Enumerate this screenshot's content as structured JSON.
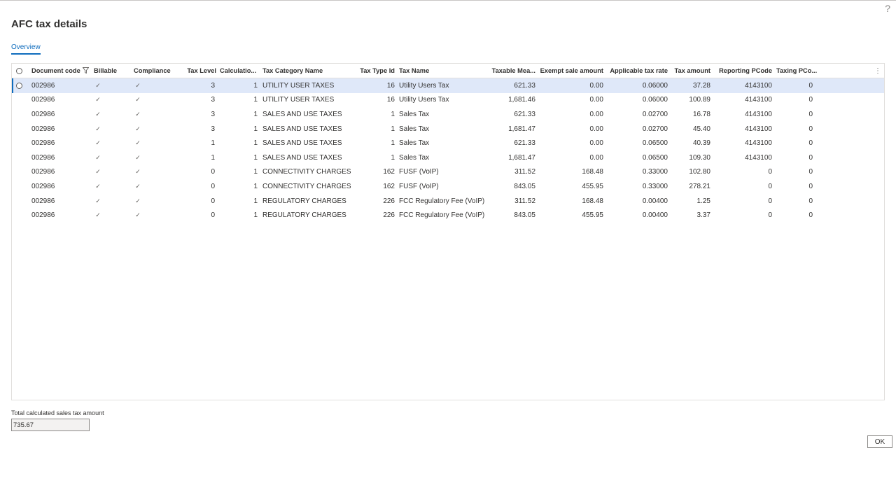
{
  "help_label": "?",
  "dialog": {
    "title": "AFC tax details",
    "tab": "Overview"
  },
  "grid": {
    "filter_icon": "funnel",
    "more_icon": "vertical-ellipsis",
    "columns": [
      "Document code",
      "Billable",
      "Compliance",
      "Tax Level",
      "Calculatio...",
      "Tax Category Name",
      "Tax Type Id",
      "Tax Name",
      "Taxable Mea...",
      "Exempt sale amount",
      "Applicable tax rate",
      "Tax amount",
      "Reporting PCode",
      "Taxing PCo..."
    ],
    "rows": [
      {
        "doc": "002986",
        "billable": "✓",
        "compliance": "✓",
        "level": "3",
        "calc": "1",
        "category": "UTILITY USER TAXES",
        "type_id": "16",
        "tax_name": "Utility Users Tax",
        "taxable": "621.33",
        "exempt": "0.00",
        "rate": "0.06000",
        "amount": "37.28",
        "rpcode": "4143100",
        "tpcode": "0"
      },
      {
        "doc": "002986",
        "billable": "✓",
        "compliance": "✓",
        "level": "3",
        "calc": "1",
        "category": "UTILITY USER TAXES",
        "type_id": "16",
        "tax_name": "Utility Users Tax",
        "taxable": "1,681.46",
        "exempt": "0.00",
        "rate": "0.06000",
        "amount": "100.89",
        "rpcode": "4143100",
        "tpcode": "0"
      },
      {
        "doc": "002986",
        "billable": "✓",
        "compliance": "✓",
        "level": "3",
        "calc": "1",
        "category": "SALES AND USE TAXES",
        "type_id": "1",
        "tax_name": "Sales Tax",
        "taxable": "621.33",
        "exempt": "0.00",
        "rate": "0.02700",
        "amount": "16.78",
        "rpcode": "4143100",
        "tpcode": "0"
      },
      {
        "doc": "002986",
        "billable": "✓",
        "compliance": "✓",
        "level": "3",
        "calc": "1",
        "category": "SALES AND USE TAXES",
        "type_id": "1",
        "tax_name": "Sales Tax",
        "taxable": "1,681.47",
        "exempt": "0.00",
        "rate": "0.02700",
        "amount": "45.40",
        "rpcode": "4143100",
        "tpcode": "0"
      },
      {
        "doc": "002986",
        "billable": "✓",
        "compliance": "✓",
        "level": "1",
        "calc": "1",
        "category": "SALES AND USE TAXES",
        "type_id": "1",
        "tax_name": "Sales Tax",
        "taxable": "621.33",
        "exempt": "0.00",
        "rate": "0.06500",
        "amount": "40.39",
        "rpcode": "4143100",
        "tpcode": "0"
      },
      {
        "doc": "002986",
        "billable": "✓",
        "compliance": "✓",
        "level": "1",
        "calc": "1",
        "category": "SALES AND USE TAXES",
        "type_id": "1",
        "tax_name": "Sales Tax",
        "taxable": "1,681.47",
        "exempt": "0.00",
        "rate": "0.06500",
        "amount": "109.30",
        "rpcode": "4143100",
        "tpcode": "0"
      },
      {
        "doc": "002986",
        "billable": "✓",
        "compliance": "✓",
        "level": "0",
        "calc": "1",
        "category": "CONNECTIVITY CHARGES",
        "type_id": "162",
        "tax_name": "FUSF (VoIP)",
        "taxable": "311.52",
        "exempt": "168.48",
        "rate": "0.33000",
        "amount": "102.80",
        "rpcode": "0",
        "tpcode": "0"
      },
      {
        "doc": "002986",
        "billable": "✓",
        "compliance": "✓",
        "level": "0",
        "calc": "1",
        "category": "CONNECTIVITY CHARGES",
        "type_id": "162",
        "tax_name": "FUSF (VoIP)",
        "taxable": "843.05",
        "exempt": "455.95",
        "rate": "0.33000",
        "amount": "278.21",
        "rpcode": "0",
        "tpcode": "0"
      },
      {
        "doc": "002986",
        "billable": "✓",
        "compliance": "✓",
        "level": "0",
        "calc": "1",
        "category": "REGULATORY CHARGES",
        "type_id": "226",
        "tax_name": "FCC Regulatory Fee (VoIP)",
        "taxable": "311.52",
        "exempt": "168.48",
        "rate": "0.00400",
        "amount": "1.25",
        "rpcode": "0",
        "tpcode": "0"
      },
      {
        "doc": "002986",
        "billable": "✓",
        "compliance": "✓",
        "level": "0",
        "calc": "1",
        "category": "REGULATORY CHARGES",
        "type_id": "226",
        "tax_name": "FCC Regulatory Fee (VoIP)",
        "taxable": "843.05",
        "exempt": "455.95",
        "rate": "0.00400",
        "amount": "3.37",
        "rpcode": "0",
        "tpcode": "0"
      }
    ]
  },
  "total": {
    "label": "Total calculated sales tax amount",
    "value": "735.67"
  },
  "ok_label": "OK"
}
